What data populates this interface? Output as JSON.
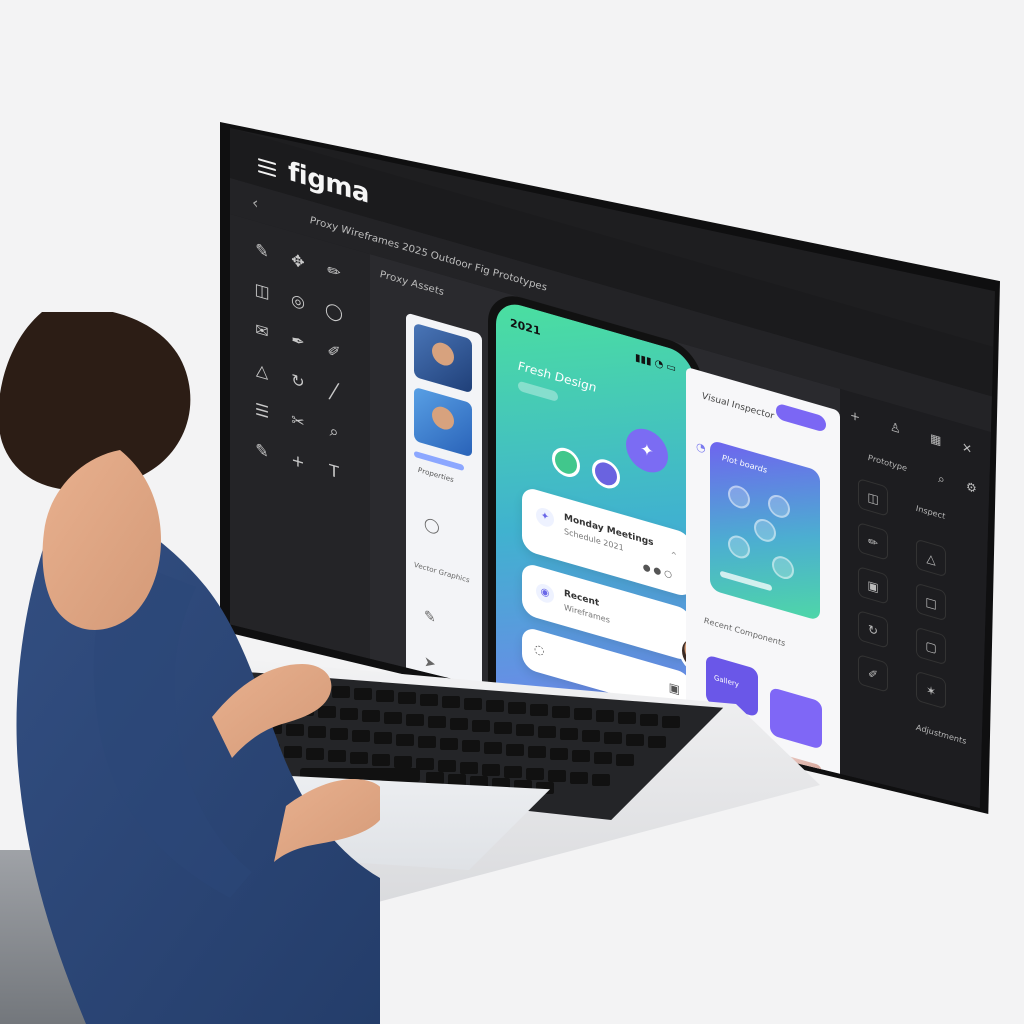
{
  "app": {
    "brand": "figma"
  },
  "toolbar": {
    "breadcrumb": "Proxy Wireframes 2025 Outdoor Fig Prototypes"
  },
  "panels": {
    "middle_header": "Proxy Assets"
  },
  "phone": {
    "time": "2021",
    "title": "Fresh Design",
    "cards": [
      {
        "title": "Monday Meetings",
        "subtitle": "Schedule 2021"
      },
      {
        "title": "Recent",
        "subtitle": "Wireframes"
      },
      {
        "title": "",
        "subtitle": ""
      }
    ]
  },
  "right_panel": {
    "title": "Visual Inspector",
    "card_label": "Plot boards",
    "list_label": "Recent Components",
    "tile_labels": [
      "Gallery",
      ""
    ]
  },
  "sidebar_labels": {
    "left": [
      "Properties",
      "Vector Graphics"
    ],
    "right": [
      "Prototype",
      "Inspect",
      "Adjustments"
    ]
  },
  "icons": {
    "menu": "menu-icon",
    "back": "chevron-left-icon",
    "search": "search-icon",
    "settings": "gear-icon"
  },
  "colors": {
    "ui_dark": "#1e1e20",
    "accent_purple": "#6d67ef",
    "accent_green": "#4be09f"
  }
}
